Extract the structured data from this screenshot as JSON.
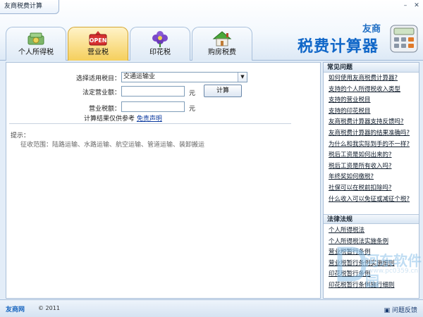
{
  "window": {
    "title": "友商税费计算",
    "controls": [
      "–",
      "✕"
    ]
  },
  "tabs": [
    {
      "label": "个人所得税",
      "icon": "money-icon",
      "active": false
    },
    {
      "label": "营业税",
      "icon": "open-sign-icon",
      "active": true
    },
    {
      "label": "印花税",
      "icon": "flower-icon",
      "active": false
    },
    {
      "label": "购房税费",
      "icon": "house-icon",
      "active": false
    }
  ],
  "logo": {
    "brand": "友商",
    "title": "税费计算器",
    "icon": "calculator-icon"
  },
  "form": {
    "select_label": "选择适用税目：",
    "select_value": "交通运输业",
    "revenue_label": "法定营业额：",
    "revenue_value": "",
    "revenue_unit": "元",
    "calc_button": "计算",
    "tax_label": "营业税额：",
    "tax_value": "",
    "tax_unit": "元",
    "note": "计算结果仅供参考",
    "disclaimer": "免责声明"
  },
  "tip": {
    "title": "提示：",
    "text": "征收范围：陆路运输、水路运输、航空运输、管道运输、装卸搬运"
  },
  "sidebar": {
    "faq_title": "常见问题",
    "faq": [
      "如何使用友商税费计算器?",
      "支持的个人所得税收入类型",
      "支持的营业税目",
      "支持的印花税目",
      "友商税费计算器支持反馈吗?",
      "友商税费计算器的结果准确吗?",
      "为什么和我实际到手的不一样?",
      "税后工资是如何出来的?",
      "税后工资是所有收入吗?",
      "年终奖如何缴税?",
      "社保可以在税前扣除吗?",
      "什么收入可以免征或减征个税?"
    ],
    "law_title": "法律法规",
    "laws": [
      "个人所得税法",
      "个人所得税法实施条例",
      "营业税暂行条例",
      "营业税暂行条例实施细则",
      "印花税暂行条例",
      "印花税暂行条例施行细则"
    ]
  },
  "watermark": {
    "text": "河东软件园",
    "url": "www.pc0359.cn"
  },
  "footer": {
    "logo": "友商网",
    "copyright": "© 2011",
    "feedback": "问题反馈"
  }
}
